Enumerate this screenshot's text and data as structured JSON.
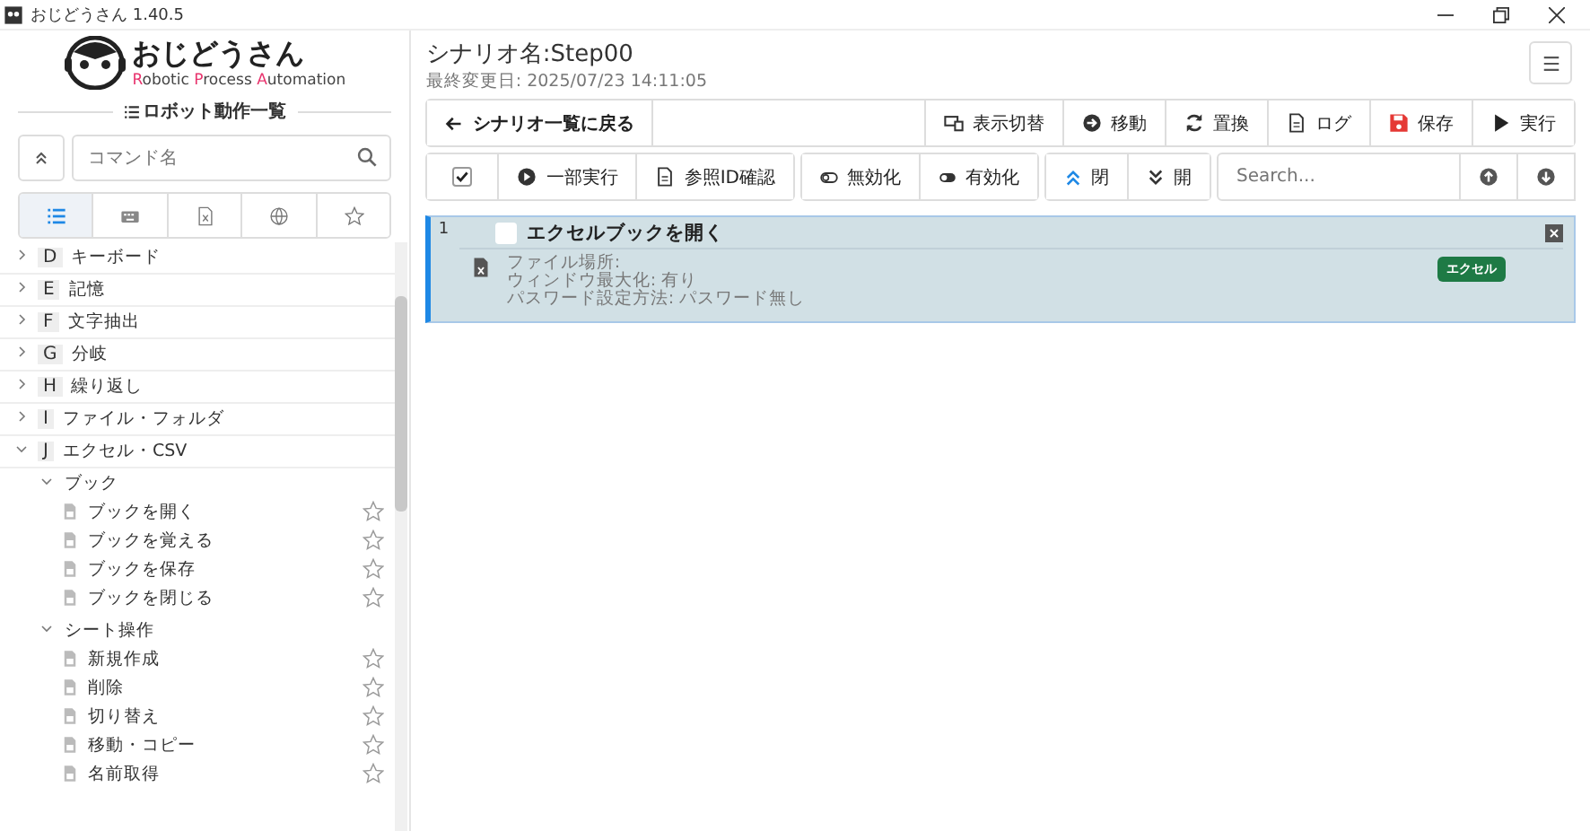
{
  "window": {
    "title": "おじどうさん 1.40.5"
  },
  "logo": {
    "name": "おじどうさん",
    "tagline_parts": [
      {
        "text": "R",
        "accent": true
      },
      {
        "text": "obotic ",
        "accent": false
      },
      {
        "text": "P",
        "accent": true
      },
      {
        "text": "rocess ",
        "accent": false
      },
      {
        "text": "A",
        "accent": true
      },
      {
        "text": "utomation",
        "accent": false
      }
    ]
  },
  "sidebar": {
    "heading": "ロボット動作一覧",
    "search": {
      "placeholder": "コマンド名"
    },
    "tabs": [
      {
        "selected": true
      },
      {
        "selected": false
      },
      {
        "selected": false
      },
      {
        "selected": false
      },
      {
        "selected": false
      }
    ],
    "tree": [
      {
        "letter": "D",
        "label": "キーボード",
        "expanded": false
      },
      {
        "letter": "E",
        "label": "記憶",
        "expanded": false
      },
      {
        "letter": "F",
        "label": "文字抽出",
        "expanded": false
      },
      {
        "letter": "G",
        "label": "分岐",
        "expanded": false
      },
      {
        "letter": "H",
        "label": "繰り返し",
        "expanded": false
      },
      {
        "letter": "I",
        "label": "ファイル・フォルダ",
        "expanded": false
      },
      {
        "letter": "J",
        "label": "エクセル・CSV",
        "expanded": true,
        "children": [
          {
            "label": "ブック",
            "expanded": true,
            "children": [
              {
                "label": "ブックを開く",
                "starred": false
              },
              {
                "label": "ブックを覚える",
                "starred": false
              },
              {
                "label": "ブックを保存",
                "starred": false
              },
              {
                "label": "ブックを閉じる",
                "starred": false
              }
            ]
          },
          {
            "label": "シート操作",
            "expanded": true,
            "children": [
              {
                "label": "新規作成",
                "starred": false
              },
              {
                "label": "削除",
                "starred": false
              },
              {
                "label": "切り替え",
                "starred": false
              },
              {
                "label": "移動・コピー",
                "starred": false
              },
              {
                "label": "名前取得",
                "starred": false
              }
            ]
          }
        ]
      }
    ]
  },
  "scenario": {
    "name": "シナリオ名:Step00",
    "modified": "最終変更日: 2025/07/23 14:11:05"
  },
  "toolbar": {
    "back": "シナリオ一覧に戻る",
    "buttons": [
      "表示切替",
      "移動",
      "置換",
      "ログ",
      "保存",
      "実行"
    ]
  },
  "actions": {
    "select_all": {
      "checked": true
    },
    "groups": [
      [
        "一部実行",
        "参照ID確認"
      ],
      [
        "無効化",
        "有効化"
      ],
      [
        "閉",
        "開"
      ]
    ],
    "search": {
      "placeholder": "Search..."
    }
  },
  "steps": [
    {
      "number": "1",
      "checked": false,
      "selected": true,
      "title": "エクセルブックを開く",
      "details": [
        "ファイル場所:",
        "ウィンドウ最大化: 有り",
        "パスワード設定方法: パスワード無し"
      ],
      "tag": "エクセル"
    }
  ]
}
